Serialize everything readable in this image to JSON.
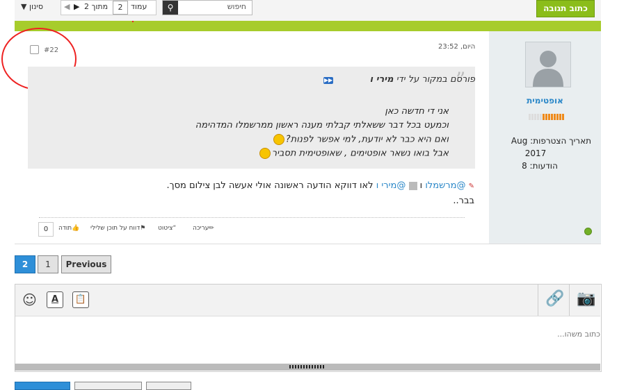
{
  "header": {
    "reply_button": "כתוב תגובה",
    "search_placeholder": "חיפוש",
    "page_label": "עמוד",
    "page_value": "2",
    "of_label": "מתוך 2",
    "filter_label": "סינון"
  },
  "post": {
    "date": "היום, 23:52",
    "number": "#22",
    "user": {
      "name": "אופטימית",
      "join_label": "תאריך הצטרפות: Aug",
      "join_year": "2017",
      "posts_label": "הודעות: 8"
    },
    "quote": {
      "prefix": "פורסם במקור על ידי",
      "author": "מירי ו",
      "lines": [
        "אני די חדשה כאן",
        "וכמעט בכל דבר ששאלתי קבלתי מענה ראשון ממרשמלו המדהימה",
        "ואם היא כבר לא יודעת, למי אפשר לפנות?",
        "אבל בואו נשאר אופטימים , שאופטימית תסביר"
      ]
    },
    "body": {
      "mention1": "@מרשמלו",
      "and": "ו",
      "mention2": "@מירי ו",
      "text": "לאו דווקא הודעה ראשונה אולי אעשה לבן צילום מסך.",
      "line2": "בבר.."
    },
    "actions": {
      "edit": "עריכה",
      "quote": "ציטוט",
      "report": "דווח על תוכן שלילי",
      "thanks": "תודה",
      "likes": "0"
    }
  },
  "pagination": {
    "current": "2",
    "page1": "1",
    "previous": "Previous"
  },
  "editor": {
    "placeholder": "כתוב משהו..."
  }
}
